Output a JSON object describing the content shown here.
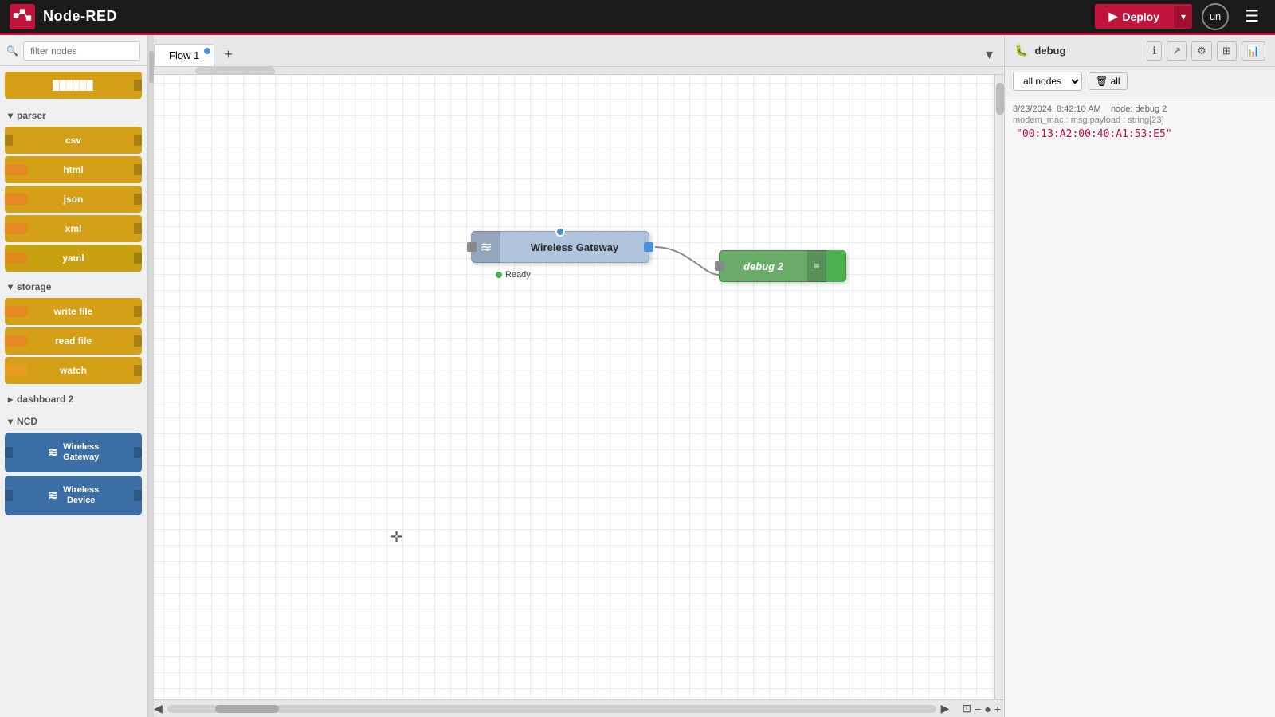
{
  "app": {
    "title": "Node-RED"
  },
  "topbar": {
    "deploy_label": "Deploy",
    "user_label": "un"
  },
  "sidebar": {
    "filter_placeholder": "filter nodes",
    "sections": [
      {
        "id": "parser",
        "label": "parser",
        "nodes": [
          "csv",
          "html",
          "json",
          "xml",
          "yaml"
        ]
      },
      {
        "id": "storage",
        "label": "storage",
        "nodes": [
          "write file",
          "read file",
          "watch"
        ]
      },
      {
        "id": "dashboard2",
        "label": "dashboard 2",
        "nodes": []
      },
      {
        "id": "ncd",
        "label": "NCD",
        "nodes": [
          "Wireless Gateway",
          "Wireless Device"
        ]
      }
    ]
  },
  "flow_tab": {
    "label": "Flow 1"
  },
  "canvas": {
    "wireless_gateway_node": {
      "label": "Wireless Gateway",
      "status": "Ready"
    },
    "debug_node": {
      "label": "debug 2"
    }
  },
  "debug_panel": {
    "title": "debug",
    "filter_label": "all nodes",
    "clear_label": "all",
    "entry": {
      "timestamp": "8/23/2024, 8:42:10 AM",
      "node": "node: debug 2",
      "path": "modem_mac : msg.payload : string[23]",
      "value": "\"00:13:A2:00:40:A1:53:E5\""
    }
  },
  "zoom": {
    "fit_icon": "⊡",
    "minus_icon": "−",
    "dot_icon": "●",
    "plus_icon": "+"
  },
  "icons": {
    "search": "🔍",
    "wifi": "≋",
    "bug": "🐛",
    "hamburger": "☰",
    "chevron_down": "▾",
    "chevron_right": "▸",
    "arrow_up": "▲",
    "arrow_down": "▼",
    "arrow_left": "◀",
    "arrow_right": "▶",
    "info": "ℹ",
    "export": "↗",
    "filter": "⚙",
    "chart": "📊",
    "close": "✕",
    "add": "+",
    "menu": "▾"
  }
}
